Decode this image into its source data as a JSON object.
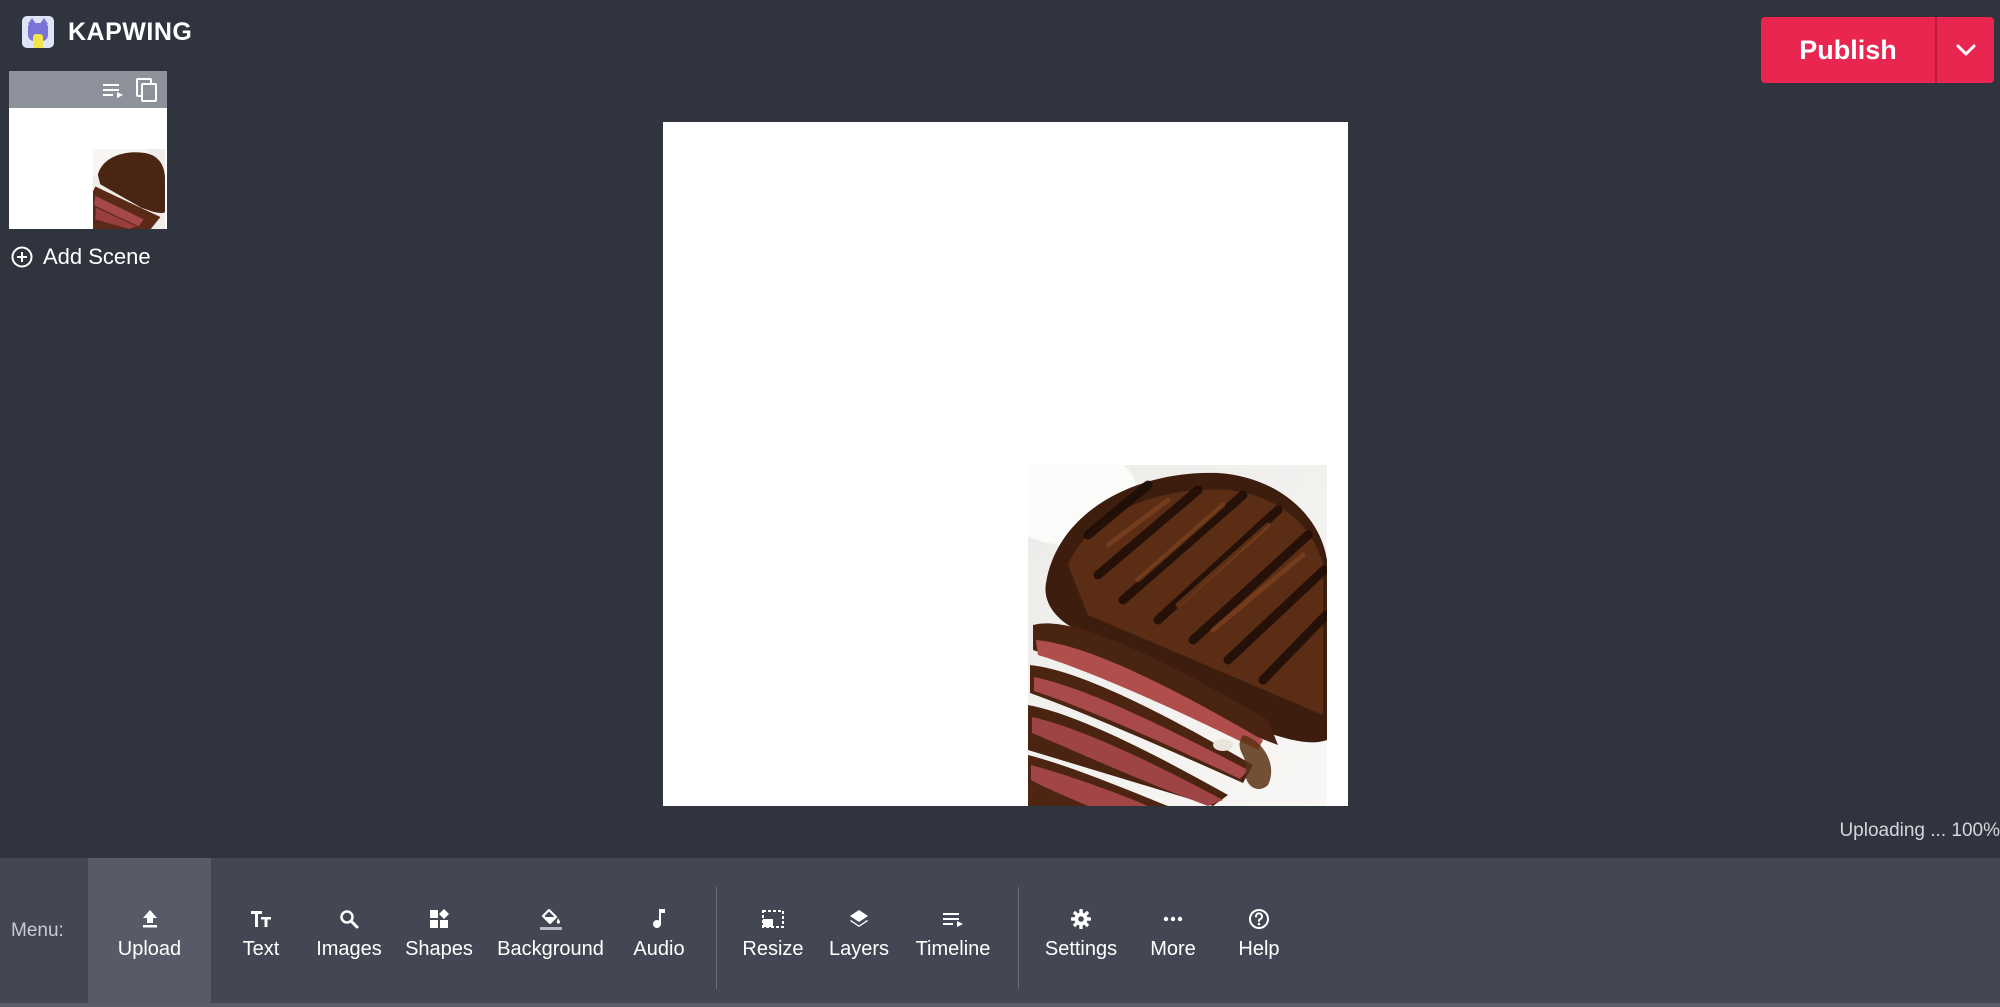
{
  "header": {
    "app_name": "KAPWING",
    "publish_label": "Publish"
  },
  "scenes": {
    "add_scene_label": "Add Scene"
  },
  "canvas": {
    "background_color": "#ffffff",
    "image_subject": "grilled sliced steak"
  },
  "status": {
    "upload_text": "Uploading ... 100%"
  },
  "toolbar": {
    "menu_label": "Menu:",
    "items": [
      {
        "label": "Upload",
        "icon": "upload-icon",
        "active": true
      },
      {
        "label": "Text",
        "icon": "text-icon"
      },
      {
        "label": "Images",
        "icon": "search-icon"
      },
      {
        "label": "Shapes",
        "icon": "shapes-icon"
      },
      {
        "label": "Background",
        "icon": "paint-bucket-icon"
      },
      {
        "label": "Audio",
        "icon": "music-note-icon"
      },
      {
        "label": "Resize",
        "icon": "resize-icon"
      },
      {
        "label": "Layers",
        "icon": "layers-icon"
      },
      {
        "label": "Timeline",
        "icon": "timeline-icon"
      },
      {
        "label": "Settings",
        "icon": "gear-icon"
      },
      {
        "label": "More",
        "icon": "more-icon"
      },
      {
        "label": "Help",
        "icon": "help-icon"
      }
    ]
  },
  "colors": {
    "background": "#30343f",
    "toolbar": "#434753",
    "accent": "#e8264f"
  }
}
